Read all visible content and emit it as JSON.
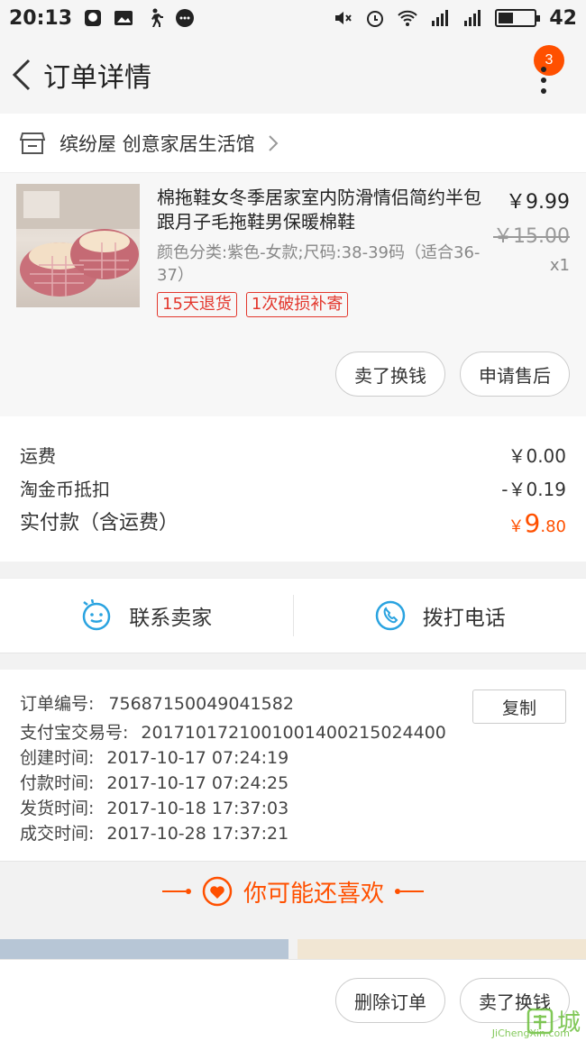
{
  "status_bar": {
    "time": "20:13",
    "battery": "42"
  },
  "nav": {
    "title": "订单详情",
    "badge_count": "3"
  },
  "store": {
    "name": "缤纷屋 创意家居生活馆"
  },
  "product": {
    "title": "棉拖鞋女冬季居家室内防滑情侣简约半包跟月子毛拖鞋男保暖棉鞋",
    "sku": "颜色分类:紫色-女款;尺码:38-39码（适合36-37）",
    "price": "￥9.99",
    "original_price": "￥15.00",
    "quantity": "x1",
    "tags": [
      "15天退货",
      "1次破损补寄"
    ],
    "buttons": {
      "sell": "卖了换钱",
      "after_sale": "申请售后"
    }
  },
  "summary": {
    "shipping_label": "运费",
    "shipping_value": "￥0.00",
    "coin_label": "淘金币抵扣",
    "coin_value": "-￥0.19",
    "total_label": "实付款（含运费）",
    "total_symbol": "￥",
    "total_int": "9",
    "total_dec": ".80"
  },
  "contact": {
    "seller": "联系卖家",
    "phone": "拨打电话"
  },
  "order_info": {
    "order_no_label": "订单编号:",
    "order_no": "75687150049041582",
    "copy": "复制",
    "alipay_label": "支付宝交易号:",
    "alipay_no": "2017101721001001400215024400",
    "created_label": "创建时间:",
    "created": "2017-10-17 07:24:19",
    "paid_label": "付款时间:",
    "paid": "2017-10-17 07:24:25",
    "shipped_label": "发货时间:",
    "shipped": "2017-10-18 17:37:03",
    "done_label": "成交时间:",
    "done": "2017-10-28 17:37:21"
  },
  "recommend": {
    "title": "你可能还喜欢"
  },
  "bottom": {
    "delete": "删除订单",
    "sell": "卖了换钱"
  },
  "watermark": {
    "text": "城",
    "sub": "JiChengXin.com"
  },
  "colors": {
    "accent": "#ff5000",
    "tag_red": "#e3372d",
    "icon_blue": "#2aa3e0"
  }
}
